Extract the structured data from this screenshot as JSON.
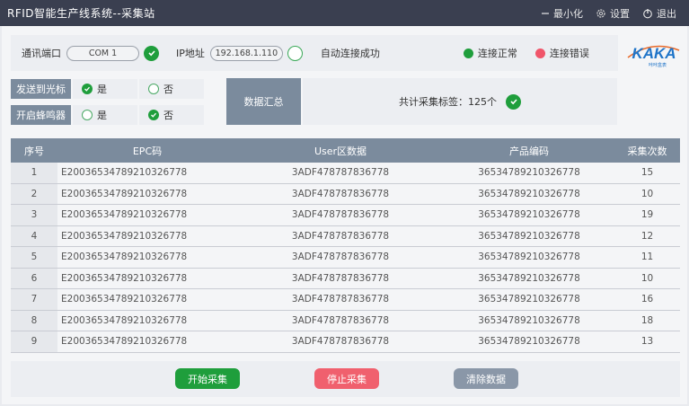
{
  "window": {
    "title": "RFID智能生产线系统--采集站",
    "minimize_label": "最小化",
    "settings_label": "设置",
    "exit_label": "退出"
  },
  "connection": {
    "port_label": "通讯端口",
    "port_value": "COM 1",
    "ip_label": "IP地址",
    "ip_value": "192.168.1.110",
    "auto_status": "自动连接成功",
    "legend_ok": "连接正常",
    "legend_error": "连接错误",
    "ok_color": "#1f9e3c",
    "error_color": "#f0556a"
  },
  "logo": {
    "text": "KAKA",
    "sub": "咔咔盒表"
  },
  "options": {
    "send_cursor_label": "发送到光标",
    "send_cursor_yes": "是",
    "send_cursor_no": "否",
    "send_cursor_selected": "是",
    "buzzer_label": "开启蜂鸣器",
    "buzzer_yes": "是",
    "buzzer_no": "否",
    "buzzer_selected": "否"
  },
  "summary": {
    "button_label": "数据汇总",
    "total_text": "共计采集标签：125个"
  },
  "table": {
    "headers": [
      "序号",
      "EPC码",
      "User区数据",
      "产品编码",
      "采集次数"
    ],
    "rows": [
      {
        "no": "1",
        "epc": "E20036534789210326778",
        "user": "3ADF478787836778",
        "code": "36534789210326778",
        "count": "15"
      },
      {
        "no": "2",
        "epc": "E20036534789210326778",
        "user": "3ADF478787836778",
        "code": "36534789210326778",
        "count": "10"
      },
      {
        "no": "3",
        "epc": "E20036534789210326778",
        "user": "3ADF478787836778",
        "code": "36534789210326778",
        "count": "19"
      },
      {
        "no": "4",
        "epc": "E20036534789210326778",
        "user": "3ADF478787836778",
        "code": "36534789210326778",
        "count": "12"
      },
      {
        "no": "5",
        "epc": "E20036534789210326778",
        "user": "3ADF478787836778",
        "code": "36534789210326778",
        "count": "11"
      },
      {
        "no": "6",
        "epc": "E20036534789210326778",
        "user": "3ADF478787836778",
        "code": "36534789210326778",
        "count": "10"
      },
      {
        "no": "7",
        "epc": "E20036534789210326778",
        "user": "3ADF478787836778",
        "code": "36534789210326778",
        "count": "16"
      },
      {
        "no": "8",
        "epc": "E20036534789210326778",
        "user": "3ADF478787836778",
        "code": "36534789210326778",
        "count": "18"
      },
      {
        "no": "9",
        "epc": "E20036534789210326778",
        "user": "3ADF478787836778",
        "code": "36534789210326778",
        "count": "13"
      }
    ]
  },
  "footer": {
    "start_label": "开始采集",
    "stop_label": "停止采集",
    "clear_label": "清除数据",
    "start_color": "#1f9e3c",
    "stop_color": "#f0606e",
    "clear_color": "#8a97a8"
  }
}
